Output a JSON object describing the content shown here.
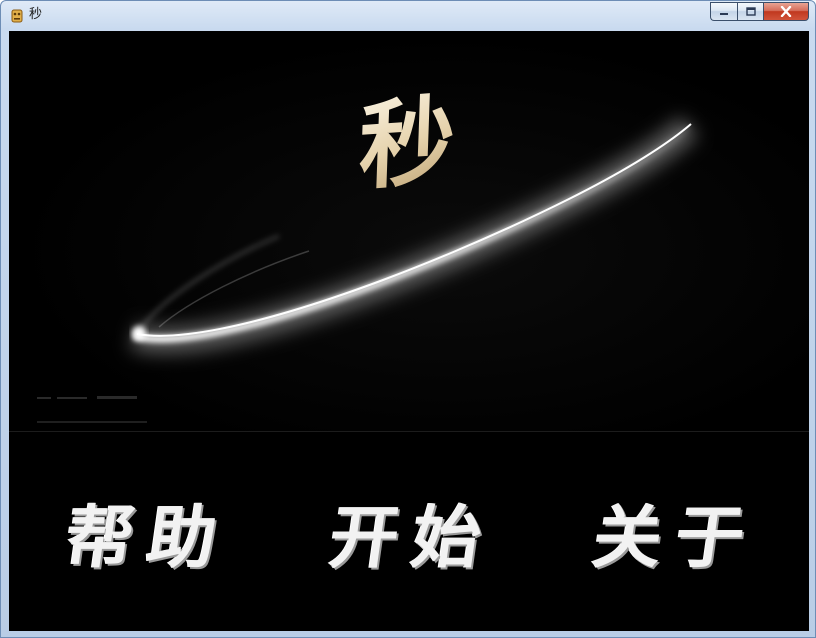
{
  "window": {
    "title": "秒",
    "icon": "app-icon",
    "controls": {
      "minimize_icon": "minimize-icon",
      "maximize_icon": "maximize-icon",
      "close_icon": "close-icon"
    }
  },
  "splash": {
    "logo_text": "秒"
  },
  "menu": {
    "help_label": "帮助",
    "start_label": "开始",
    "about_label": "关于"
  }
}
